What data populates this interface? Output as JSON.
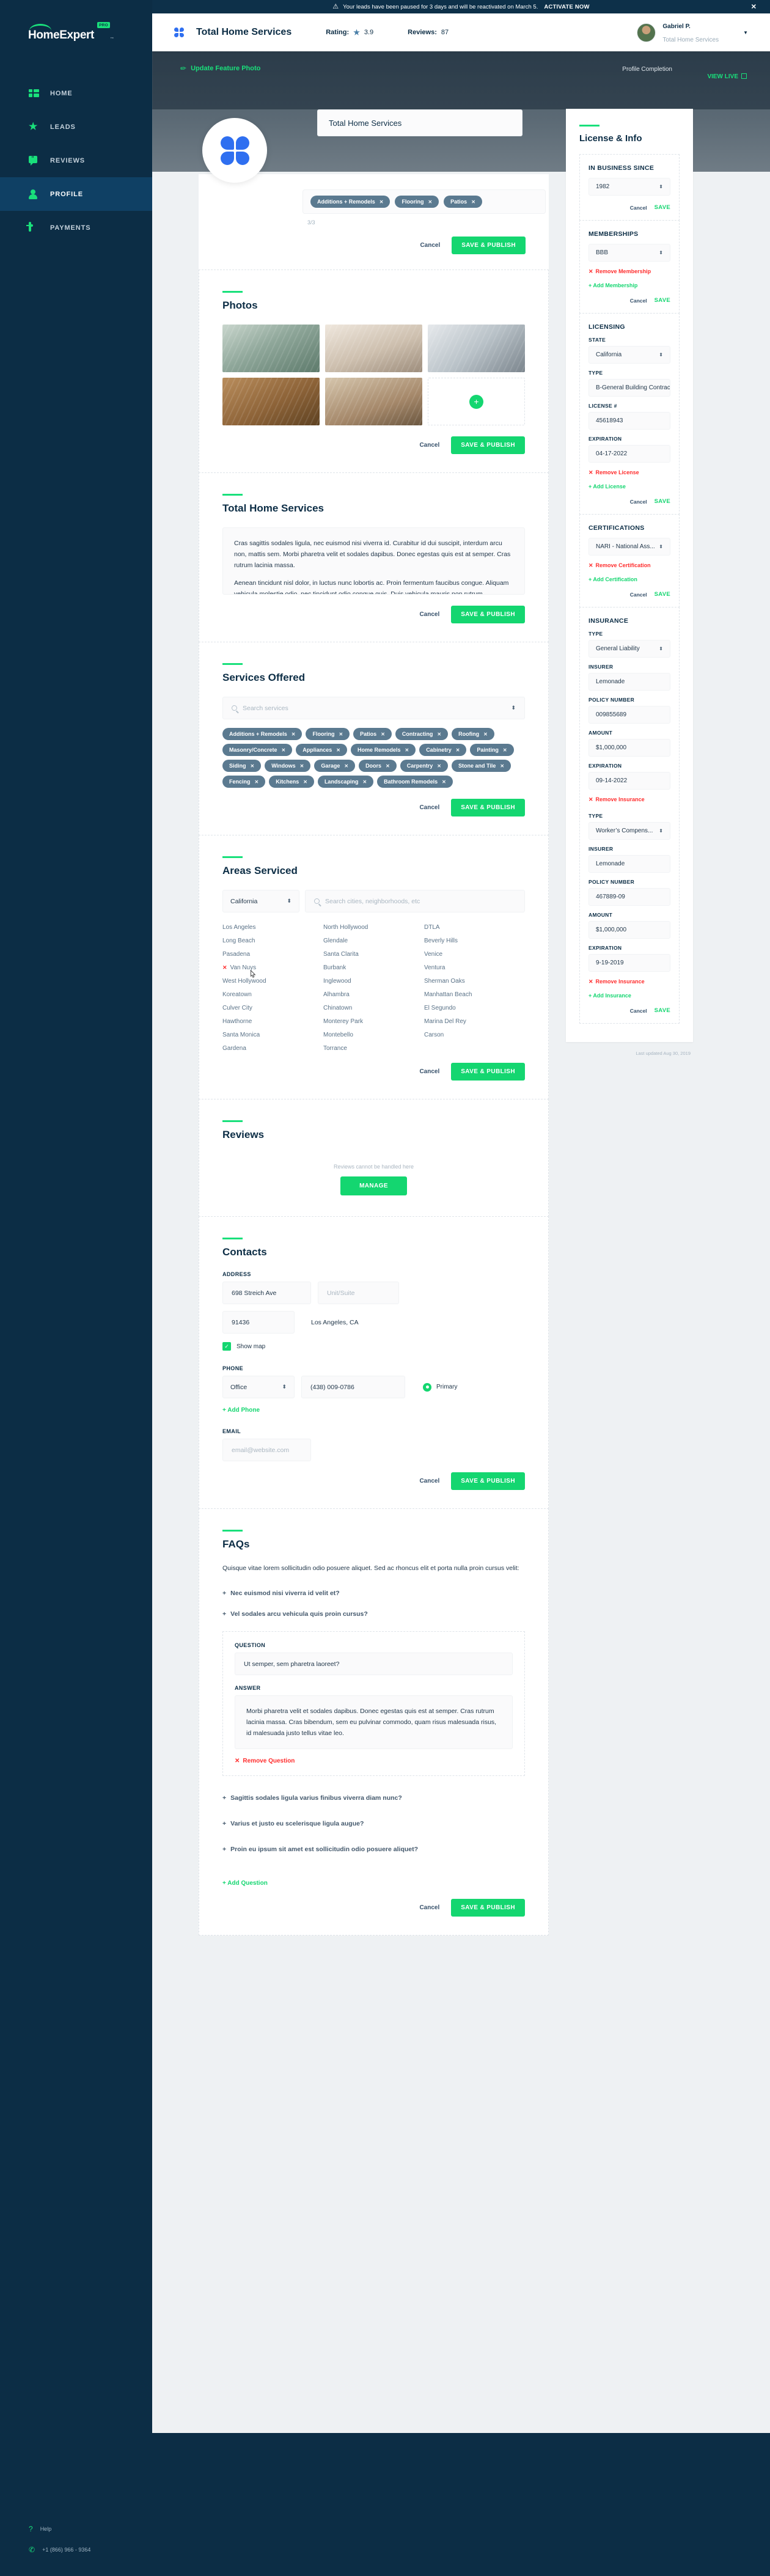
{
  "alert": {
    "icon": "warning-icon",
    "message": "Your leads have been paused for 3 days and will be reactivated on March 5.",
    "cta": "ACTIVATE NOW",
    "close": "✕"
  },
  "sidebar": {
    "logo": {
      "text": "HomeExpert",
      "badge": "PRO",
      "tm": "™"
    },
    "items": [
      {
        "label": "HOME",
        "icon": "dashboard-icon",
        "active": false
      },
      {
        "label": "LEADS",
        "icon": "star-icon",
        "active": false
      },
      {
        "label": "REVIEWS",
        "icon": "quote-bubble-icon",
        "active": false
      },
      {
        "label": "PROFILE",
        "icon": "person-icon",
        "active": true
      },
      {
        "label": "PAYMENTS",
        "icon": "card-icon",
        "active": false
      }
    ],
    "footer": {
      "help": "Help",
      "help_icon": "question-icon",
      "phone": "+1 (866) 966 - 9364",
      "phone_icon": "phone-icon"
    }
  },
  "topbar": {
    "title": "Total Home Services",
    "rating_label": "Rating:",
    "rating_value": "3.9",
    "reviews_label": "Reviews:",
    "reviews_value": "87",
    "user_name": "Gabriel P.",
    "user_company": "Total Home Services",
    "caret": "▼"
  },
  "hero": {
    "update_photo": "Update Feature Photo",
    "update_photo_icon": "pencil-icon",
    "profile_completion": "Profile Completion",
    "view_live": "VIEW LIVE",
    "view_live_icon": "external-link-icon"
  },
  "business": {
    "name_value": "Total Home Services",
    "top_tags": [
      "Additions + Remodels",
      "Flooring",
      "Patios"
    ],
    "counter": "3/3"
  },
  "buttons": {
    "cancel": "Cancel",
    "save_publish": "SAVE & PUBLISH",
    "save": "SAVE",
    "manage": "MANAGE"
  },
  "photos": {
    "title": "Photos",
    "items": [
      "photo-living-room",
      "photo-bathroom",
      "photo-kitchen",
      "photo-wood-floor",
      "photo-hallway"
    ],
    "add_label": "+"
  },
  "about": {
    "title": "Total Home Services",
    "paragraph1": "Cras sagittis sodales ligula, nec euismod nisi viverra id. Curabitur id dui suscipit, interdum arcu non, mattis sem. Morbi pharetra velit et sodales dapibus. Donec egestas quis est at semper. Cras rutrum lacinia massa.",
    "paragraph2": "Aenean tincidunt nisl dolor, in luctus nunc lobortis ac. Proin fermentum faucibus congue. Aliquam vehicula molestie odio, nec tincidunt odio congue quis. Duis vehicula mauris non rutrum"
  },
  "services": {
    "title": "Services Offered",
    "search_placeholder": "Search services",
    "search_icon": "search-icon",
    "tags": [
      "Additions + Remodels",
      "Flooring",
      "Patios",
      "Contracting",
      "Roofing",
      "Masonry/Concrete",
      "Appliances",
      "Home Remodels",
      "Cabinetry",
      "Painting",
      "Siding",
      "Windows",
      "Garage",
      "Doors",
      "Carpentry",
      "Stone and Tile",
      "Fencing",
      "Kitchens",
      "Landscaping",
      "Bathroom Remodels"
    ]
  },
  "areas": {
    "title": "Areas Serviced",
    "state": "California",
    "search_placeholder": "Search cities, neighborhoods, etc",
    "search_icon": "search-icon",
    "cities": [
      "Los Angeles",
      "North Hollywood",
      "DTLA",
      "Long Beach",
      "Glendale",
      "Beverly Hills",
      "Pasadena",
      "Santa Clarita",
      "Venice",
      "Van Nuys",
      "Burbank",
      "Ventura",
      "West Hollywood",
      "Inglewood",
      "Sherman Oaks",
      "Koreatown",
      "Alhambra",
      "Manhattan Beach",
      "Culver City",
      "Chinatown",
      "El Segundo",
      "Hawthorne",
      "Monterey Park",
      "Marina Del Rey",
      "Santa Monica",
      "Montebello",
      "Carson",
      "Gardena",
      "Torrance",
      ""
    ],
    "removing_city": "Van Nuys"
  },
  "reviews": {
    "title": "Reviews",
    "note": "Reviews cannot be handled here"
  },
  "contacts": {
    "title": "Contacts",
    "address_label": "ADDRESS",
    "address_value": "698 Streich Ave",
    "unit_placeholder": "Unit/Suite",
    "zip_value": "91436",
    "city_state": "Los Angeles, CA",
    "show_map_label": "Show map",
    "show_map_checked": true,
    "phone_label": "PHONE",
    "phone_type": "Office",
    "phone_value": "(438) 009-0786",
    "primary_label": "Primary",
    "add_phone": "+ Add Phone",
    "email_label": "EMAIL",
    "email_placeholder": "email@website.com"
  },
  "faqs": {
    "title": "FAQs",
    "intro": "Quisque vitae lorem sollicitudin odio posuere aliquet. Sed ac rhoncus elit et porta nulla proin cursus velit:",
    "collapsed_top": [
      "Nec euismod nisi viverra id velit et?",
      "Vel sodales arcu vehicula quis proin cursus?"
    ],
    "open_item": {
      "question_label": "QUESTION",
      "question_value": "Ut semper, sem pharetra laoreet?",
      "answer_label": "ANSWER",
      "answer_value": "Morbi pharetra velit et sodales dapibus. Donec egestas quis est at semper. Cras rutrum lacinia massa. Cras bibendum, sem eu pulvinar commodo, quam risus malesuada risus, id malesuada justo tellus vitae leo.",
      "remove": "Remove Question"
    },
    "collapsed_bottom": [
      "Sagittis sodales ligula varius finibus viverra diam nunc?",
      "Varius et justo eu scelerisque ligula augue?",
      "Proin eu ipsum sit amet est sollicitudin odio posuere aliquet?"
    ],
    "add_question": "+ Add Question"
  },
  "license_panel": {
    "title": "License & Info",
    "in_business_since": {
      "label": "IN BUSINESS SINCE",
      "value": "1982"
    },
    "memberships": {
      "label": "MEMBERSHIPS",
      "value": "BBB",
      "remove": "Remove Membership",
      "add": "+ Add Membership"
    },
    "licensing": {
      "label": "LICENSING",
      "state_label": "STATE",
      "state_value": "California",
      "type_label": "TYPE",
      "type_value": "B-General Building Contract",
      "license_label": "LICENSE #",
      "license_value": "45618943",
      "expiration_label": "EXPIRATION",
      "expiration_value": "04-17-2022",
      "remove": "Remove License",
      "add": "+ Add License"
    },
    "certifications": {
      "label": "CERTIFICATIONS",
      "value": "NARI - National Ass...",
      "remove": "Remove Certification",
      "add": "+ Add Certification"
    },
    "insurance": {
      "label": "INSURANCE",
      "entries": [
        {
          "type_label": "TYPE",
          "type_value": "General Liability",
          "insurer_label": "INSURER",
          "insurer_value": "Lemonade",
          "policy_label": "POLICY NUMBER",
          "policy_value": "009855689",
          "amount_label": "AMOUNT",
          "amount_value": "$1,000,000",
          "expiration_label": "EXPIRATION",
          "expiration_value": "09-14-2022",
          "remove": "Remove Insurance"
        },
        {
          "type_label": "TYPE",
          "type_value": "Worker’s Compens...",
          "insurer_label": "INSURER",
          "insurer_value": "Lemonade",
          "policy_label": "POLICY NUMBER",
          "policy_value": "467889-09",
          "amount_label": "AMOUNT",
          "amount_value": "$1,000,000",
          "expiration_label": "EXPIRATION",
          "expiration_value": "9-19-2019",
          "remove": "Remove Insurance"
        }
      ],
      "add": "+ Add Insurance"
    },
    "last_updated": "Last updated  Aug 30, 2019"
  },
  "colors": {
    "brand_green": "#14d670",
    "navy": "#0c2d45",
    "danger": "#ff2d2d",
    "tag_slate": "#5b7a90"
  }
}
